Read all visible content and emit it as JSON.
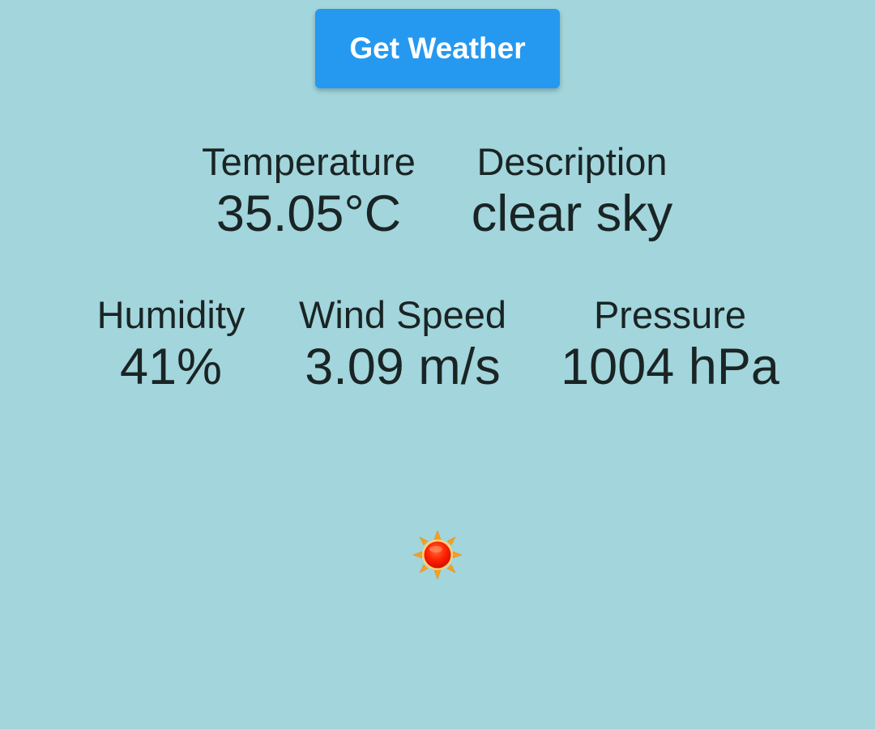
{
  "button": {
    "label": "Get Weather"
  },
  "weather": {
    "temperature": {
      "label": "Temperature",
      "value": "35.05°C"
    },
    "description": {
      "label": "Description",
      "value": "clear sky"
    },
    "humidity": {
      "label": "Humidity",
      "value": "41%"
    },
    "wind_speed": {
      "label": "Wind Speed",
      "value": "3.09 m/s"
    },
    "pressure": {
      "label": "Pressure",
      "value": "1004 hPa"
    }
  },
  "icon": {
    "name": "sun-icon"
  },
  "colors": {
    "background": "#a2d5dc",
    "button": "#2599f0",
    "button_text": "#ffffff",
    "text": "#1a2424"
  }
}
